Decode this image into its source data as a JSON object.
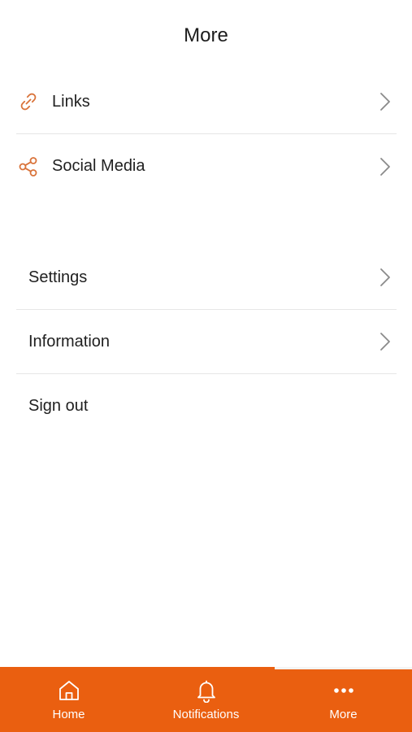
{
  "header": {
    "title": "More"
  },
  "groups": [
    {
      "items": [
        {
          "label": "Links",
          "icon": "link-icon"
        },
        {
          "label": "Social Media",
          "icon": "share-icon"
        }
      ]
    },
    {
      "items": [
        {
          "label": "Settings"
        },
        {
          "label": "Information"
        },
        {
          "label": "Sign out"
        }
      ]
    }
  ],
  "tabbar": {
    "tabs": [
      {
        "label": "Home",
        "icon": "home-icon"
      },
      {
        "label": "Notifications",
        "icon": "bell-icon"
      },
      {
        "label": "More",
        "icon": "more-dots-icon",
        "active": true
      }
    ]
  },
  "colors": {
    "accent": "#ea5f10",
    "icon_accent": "#d9733a",
    "divider": "#e6e6e6",
    "chevron": "#8a8a8a"
  }
}
